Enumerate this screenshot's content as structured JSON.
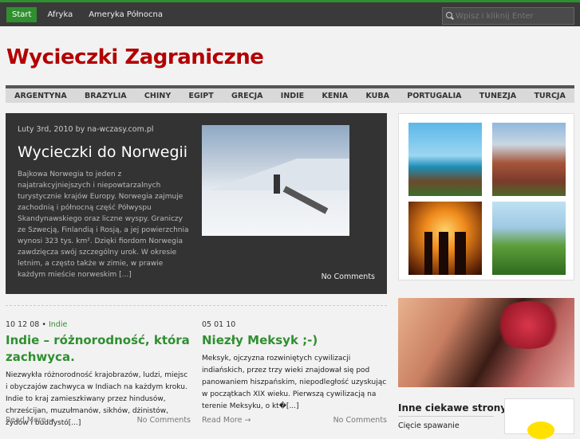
{
  "topnav": {
    "items": [
      "Start",
      "Afryka",
      "Ameryka Północnа"
    ],
    "search_placeholder": "Wpisz i kliknij Enter"
  },
  "site": {
    "title": "Wycieczki Zagraniczne"
  },
  "categories": [
    "ARGENTYNA",
    "BRAZYLIA",
    "CHINY",
    "EGIPT",
    "GRECJA",
    "INDIE",
    "KENIA",
    "KUBA",
    "PORTUGALIA",
    "TUNEZJA",
    "TURCJA"
  ],
  "feature": {
    "meta": "Luty 3rd, 2010 by na-wczasy.com.pl",
    "title": "Wycieczki do Norwegii",
    "excerpt": "Bajkowa Norwegia to jeden z najatrakcyjniejszych i niepowtarzalnych turystycznie krajów Europy. Norwegia zajmuje zachodnią i północną część Półwyspu Skandynawskiego oraz liczne wyspy. Graniczy ze Szwecją, Finlandią i Rosją, a jej powierzchnia wynosi 323 tys. km². Dzięki fiordom Norwegia zawdzięcza swój szczególny urok. W okresie letnim, a często także w zimie, w prawie każdym mieście norweskim [...]",
    "comments": "No Comments"
  },
  "posts": [
    {
      "date": "10 12 08",
      "category": "Indie",
      "title": "Indie – różnorodność, która zachwyca.",
      "excerpt": "Niezwykła różnorodność krajobrazów, ludzi, miejsc i obyczajów zachwyca w Indiach na każdym kroku. Indie to kraj zamieszkiwany przez hindusów, chrześcijan, muzułmanów, sikhów, dżinistów, żydów i buddystó[...]",
      "read_more": "Read More →",
      "comments": "No Comments"
    },
    {
      "date": "05 01 10",
      "category": "",
      "title": "Niezły Meksyk ;-)",
      "excerpt": "Meksyk, ojczyzna rozwiniętych cywilizacji indiańskich, przez trzy wieki znajdował się pod panowaniem hiszpańskim, niepodległość uzyskując w początkach XIX wieku. Pierwszą cywilizacją na terenie Meksyku, o kt�[...]",
      "read_more": "Read More →",
      "comments": "No Comments"
    }
  ],
  "sidebar": {
    "heading": "Inne ciekawe strony",
    "items": [
      "Cięcie spawanie"
    ]
  }
}
